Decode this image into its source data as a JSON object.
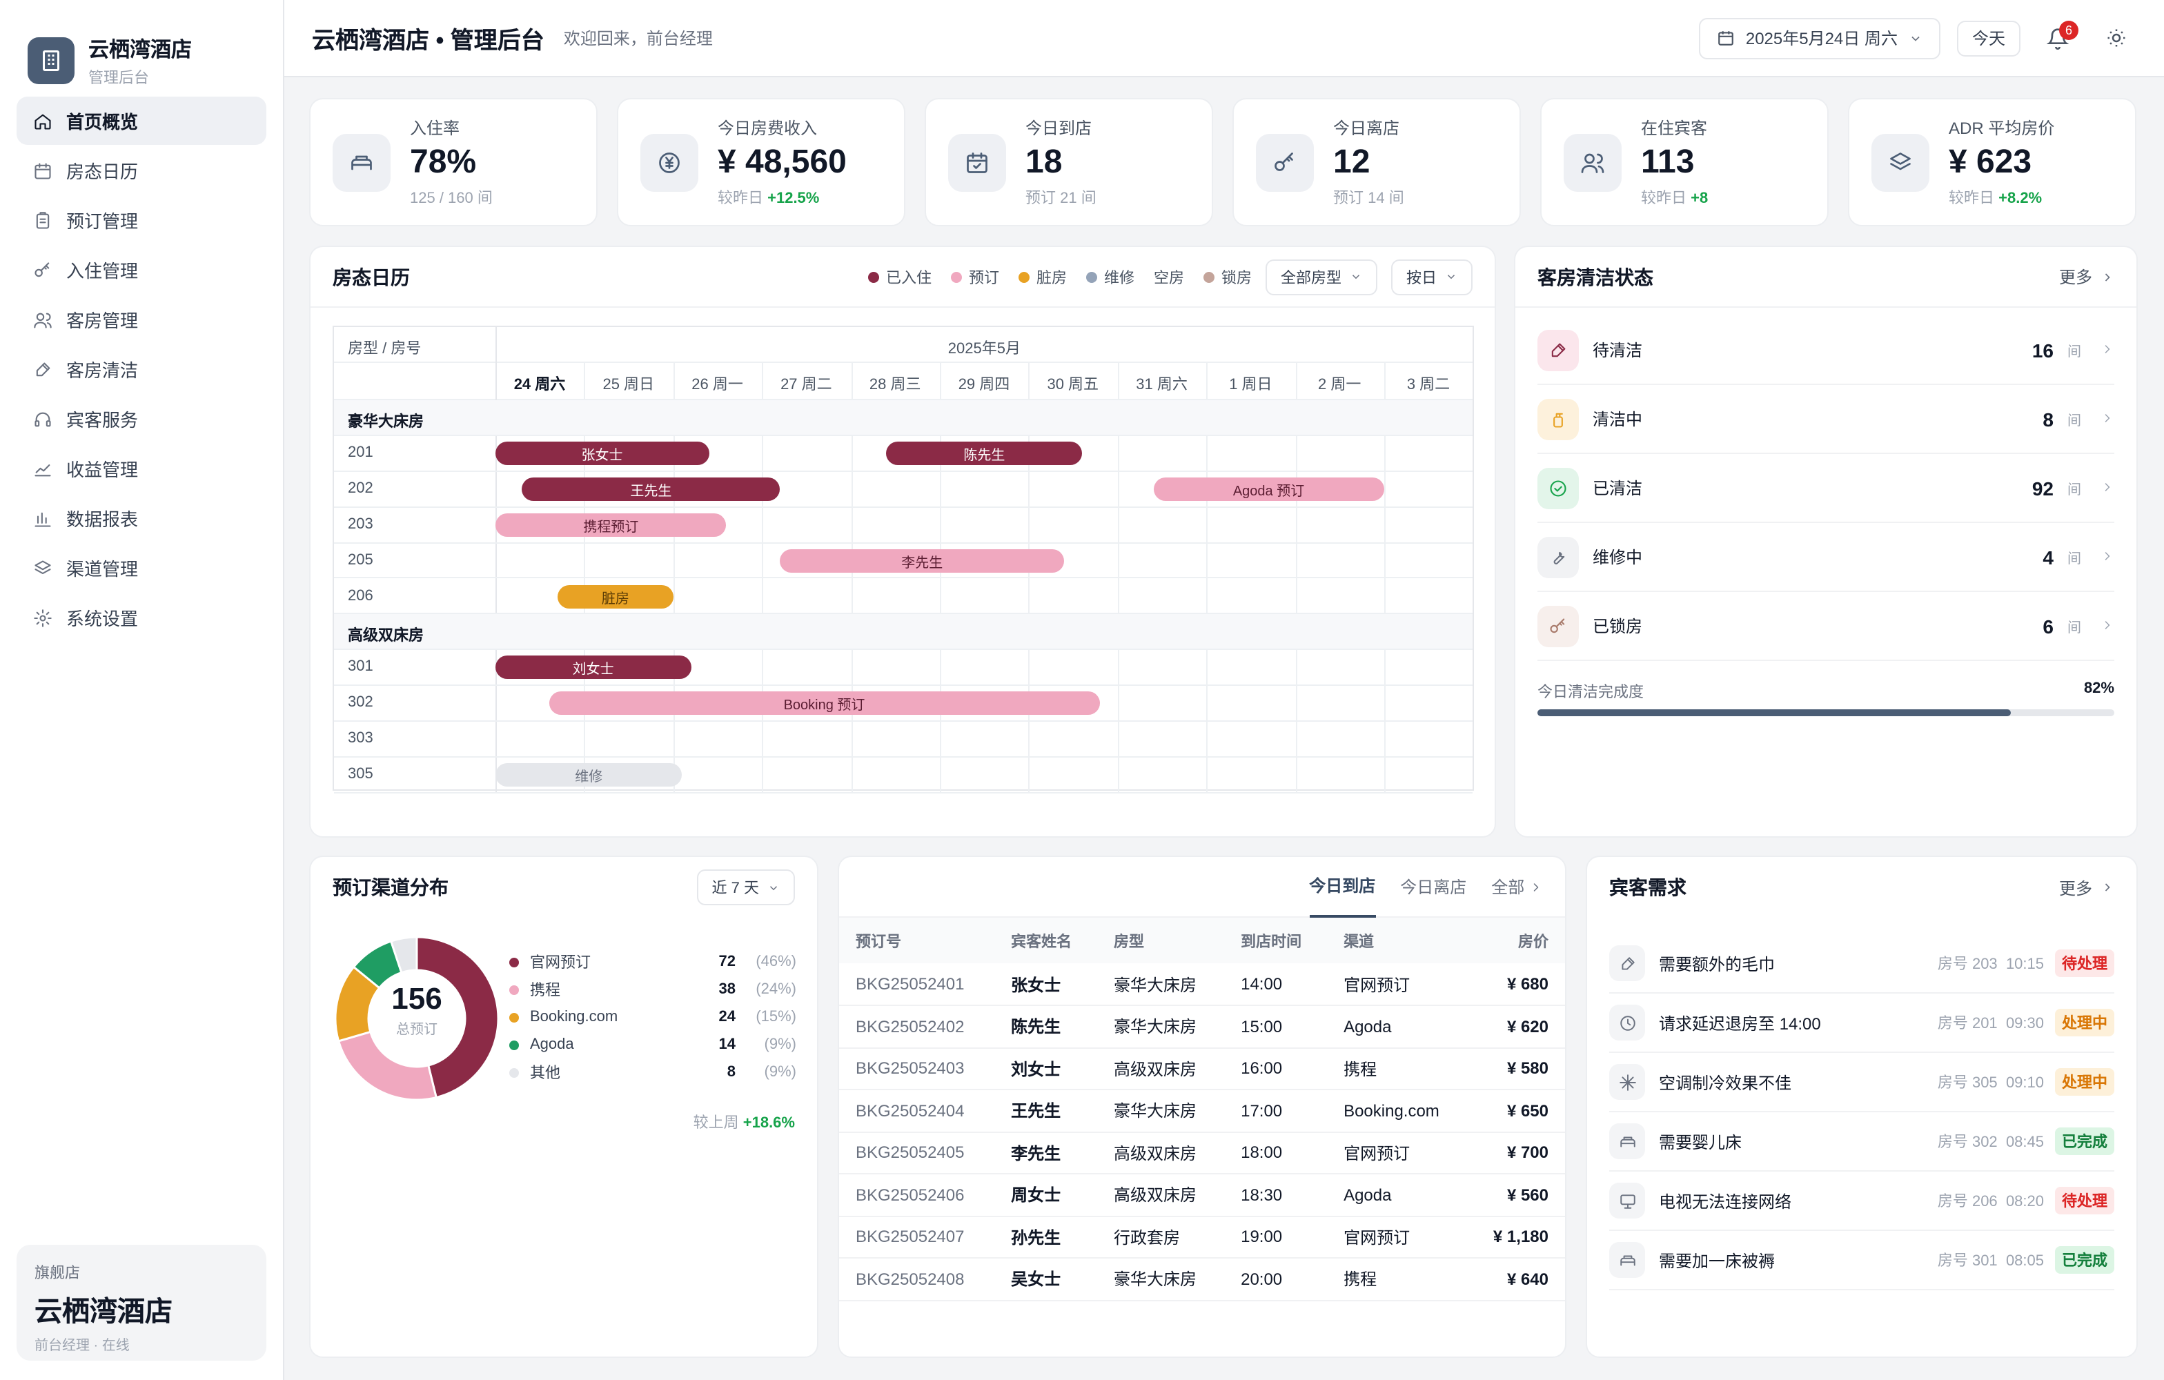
{
  "brand": {
    "name": "云栖湾酒店",
    "subtitle": "管理后台"
  },
  "nav": [
    {
      "label": "首页概览",
      "icon": "home-icon",
      "active": true
    },
    {
      "label": "房态日历",
      "icon": "calendar-icon"
    },
    {
      "label": "预订管理",
      "icon": "clipboard-icon"
    },
    {
      "label": "入住管理",
      "icon": "key-icon"
    },
    {
      "label": "客房管理",
      "icon": "users-icon"
    },
    {
      "label": "客房清洁",
      "icon": "brush-icon"
    },
    {
      "label": "宾客服务",
      "icon": "headset-icon"
    },
    {
      "label": "收益管理",
      "icon": "trend-icon"
    },
    {
      "label": "数据报表",
      "icon": "bar-chart-icon"
    },
    {
      "label": "渠道管理",
      "icon": "layers-icon"
    },
    {
      "label": "系统设置",
      "icon": "gear-icon"
    }
  ],
  "store": {
    "tag": "旗舰店",
    "name": "云栖湾酒店",
    "status": "前台经理 · 在线"
  },
  "header": {
    "title": "云栖湾酒店 • 管理后台",
    "welcome": "欢迎回来，前台经理",
    "date": "2025年5月24日 周六",
    "today": "今天",
    "notifications": "6"
  },
  "kpis": [
    {
      "label": "入住率",
      "value": "78%",
      "sub": "125 / 160 间",
      "delta": "",
      "icon": "bed-icon"
    },
    {
      "label": "今日房费收入",
      "value": "¥ 48,560",
      "sub": "较昨日",
      "delta": "+12.5%",
      "icon": "yuan-icon"
    },
    {
      "label": "今日到店",
      "value": "18",
      "sub": "预订 21 间",
      "delta": "",
      "icon": "calendar-check-icon"
    },
    {
      "label": "今日离店",
      "value": "12",
      "sub": "预订 14 间",
      "delta": "",
      "icon": "key-icon"
    },
    {
      "label": "在住宾客",
      "value": "113",
      "sub": "较昨日",
      "delta": "+8",
      "icon": "users-icon"
    },
    {
      "label": "ADR 平均房价",
      "value": "¥ 623",
      "sub": "较昨日",
      "delta": "+8.2%",
      "icon": "layers-icon"
    }
  ],
  "calendar": {
    "title": "房态日历",
    "legend": [
      {
        "label": "已入住",
        "color": "#8b2a46"
      },
      {
        "label": "预订",
        "color": "#f0a8bf"
      },
      {
        "label": "脏房",
        "color": "#e8a224"
      },
      {
        "label": "维修",
        "color": "#94a3b8"
      },
      {
        "label": "空房",
        "color": ""
      },
      {
        "label": "锁房",
        "color": "#c4a49a"
      }
    ],
    "room_type_select": "全部房型",
    "view_select": "按日",
    "corner": "房型 / 房号",
    "month": "2025年5月",
    "days": [
      "24 周六",
      "25 周日",
      "26 周一",
      "27 周二",
      "28 周三",
      "29 周四",
      "30 周五",
      "31 周六",
      "1 周日",
      "2 周一",
      "3 周二"
    ],
    "groups": [
      {
        "name": "豪华大床房",
        "rooms": [
          {
            "no": "201",
            "bookings": [
              {
                "label": "张女士",
                "status": "occ",
                "start": 0,
                "end": 2.4
              },
              {
                "label": "陈先生",
                "status": "occ",
                "start": 4.4,
                "end": 6.6
              }
            ]
          },
          {
            "no": "202",
            "bookings": [
              {
                "label": "王先生",
                "status": "occ",
                "start": 0.3,
                "end": 3.2
              },
              {
                "label": "Agoda 预订",
                "status": "res",
                "start": 7.4,
                "end": 10.0
              }
            ]
          },
          {
            "no": "203",
            "bookings": [
              {
                "label": "携程预订",
                "status": "res",
                "start": 0,
                "end": 2.6
              }
            ]
          },
          {
            "no": "205",
            "bookings": [
              {
                "label": "李先生",
                "status": "res",
                "start": 3.2,
                "end": 6.4
              }
            ]
          },
          {
            "no": "206",
            "bookings": [
              {
                "label": "脏房",
                "status": "dirty",
                "start": 0.7,
                "end": 2.0
              }
            ]
          }
        ]
      },
      {
        "name": "高级双床房",
        "rooms": [
          {
            "no": "301",
            "bookings": [
              {
                "label": "刘女士",
                "status": "occ",
                "start": 0,
                "end": 2.2
              }
            ]
          },
          {
            "no": "302",
            "bookings": [
              {
                "label": "Booking 预订",
                "status": "res",
                "start": 0.6,
                "end": 6.8
              }
            ]
          },
          {
            "no": "303",
            "bookings": []
          },
          {
            "no": "305",
            "bookings": [
              {
                "label": "维修",
                "status": "maint",
                "start": 0,
                "end": 2.1
              }
            ]
          }
        ]
      }
    ]
  },
  "housekeeping": {
    "title": "客房清洁状态",
    "more": "更多",
    "items": [
      {
        "label": "待清洁",
        "value": "16",
        "unit": "间",
        "icon": "brush-icon",
        "bg": "#fbe6ec",
        "fg": "#8b2a46"
      },
      {
        "label": "清洁中",
        "value": "8",
        "unit": "间",
        "icon": "spray-icon",
        "bg": "#fdf1dc",
        "fg": "#e8a224"
      },
      {
        "label": "已清洁",
        "value": "92",
        "unit": "间",
        "icon": "check-circle-icon",
        "bg": "#e3f5ea",
        "fg": "#16a34a"
      },
      {
        "label": "维修中",
        "value": "4",
        "unit": "间",
        "icon": "wrench-icon",
        "bg": "#f1f2f4",
        "fg": "#6b7280"
      },
      {
        "label": "已锁房",
        "value": "6",
        "unit": "间",
        "icon": "key-icon",
        "bg": "#f7efec",
        "fg": "#a97b6c"
      }
    ],
    "progress_label": "今日清洁完成度",
    "progress_text": "82%",
    "progress": 82
  },
  "channels": {
    "title": "预订渠道分布",
    "range": "近 7 天",
    "total": "156",
    "total_label": "总预订",
    "items": [
      {
        "name": "官网预订",
        "count": "72",
        "pct": "(46%)",
        "value": 72,
        "color": "#8b2a46"
      },
      {
        "name": "携程",
        "count": "38",
        "pct": "(24%)",
        "value": 38,
        "color": "#f0a8bf"
      },
      {
        "name": "Booking.com",
        "count": "24",
        "pct": "(15%)",
        "value": 24,
        "color": "#e8a224"
      },
      {
        "name": "Agoda",
        "count": "14",
        "pct": "(9%)",
        "value": 14,
        "color": "#1f9d63"
      },
      {
        "name": "其他",
        "count": "8",
        "pct": "(9%)",
        "value": 8,
        "color": "#e5e7eb"
      }
    ],
    "compare_label": "较上周",
    "compare_value": "+18.6%"
  },
  "arrivals": {
    "tabs": [
      "今日到店",
      "今日离店",
      "全部"
    ],
    "columns": [
      "预订号",
      "宾客姓名",
      "房型",
      "到店时间",
      "渠道",
      "房价"
    ],
    "rows": [
      [
        "BKG25052401",
        "张女士",
        "豪华大床房",
        "14:00",
        "官网预订",
        "¥ 680"
      ],
      [
        "BKG25052402",
        "陈先生",
        "豪华大床房",
        "15:00",
        "Agoda",
        "¥ 620"
      ],
      [
        "BKG25052403",
        "刘女士",
        "高级双床房",
        "16:00",
        "携程",
        "¥ 580"
      ],
      [
        "BKG25052404",
        "王先生",
        "豪华大床房",
        "17:00",
        "Booking.com",
        "¥ 650"
      ],
      [
        "BKG25052405",
        "李先生",
        "高级双床房",
        "18:00",
        "官网预订",
        "¥ 700"
      ],
      [
        "BKG25052406",
        "周女士",
        "高级双床房",
        "18:30",
        "Agoda",
        "¥ 560"
      ],
      [
        "BKG25052407",
        "孙先生",
        "行政套房",
        "19:00",
        "官网预订",
        "¥ 1,180"
      ],
      [
        "BKG25052408",
        "吴女士",
        "豪华大床房",
        "20:00",
        "携程",
        "¥ 640"
      ]
    ]
  },
  "requests": {
    "title": "宾客需求",
    "more": "更多",
    "items": [
      {
        "text": "需要额外的毛巾",
        "room": "房号 203",
        "time": "10:15",
        "status": "待处理",
        "kind": "pend",
        "icon": "brush-icon"
      },
      {
        "text": "请求延迟退房至 14:00",
        "room": "房号 201",
        "time": "09:30",
        "status": "处理中",
        "kind": "proc",
        "icon": "clock-icon"
      },
      {
        "text": "空调制冷效果不佳",
        "room": "房号 305",
        "time": "09:10",
        "status": "处理中",
        "kind": "proc",
        "icon": "snowflake-icon"
      },
      {
        "text": "需要婴儿床",
        "room": "房号 302",
        "time": "08:45",
        "status": "已完成",
        "kind": "done",
        "icon": "bed-icon"
      },
      {
        "text": "电视无法连接网络",
        "room": "房号 206",
        "time": "08:20",
        "status": "待处理",
        "kind": "pend",
        "icon": "monitor-icon"
      },
      {
        "text": "需要加一床被褥",
        "room": "房号 301",
        "time": "08:05",
        "status": "已完成",
        "kind": "done",
        "icon": "bed-icon"
      }
    ]
  }
}
